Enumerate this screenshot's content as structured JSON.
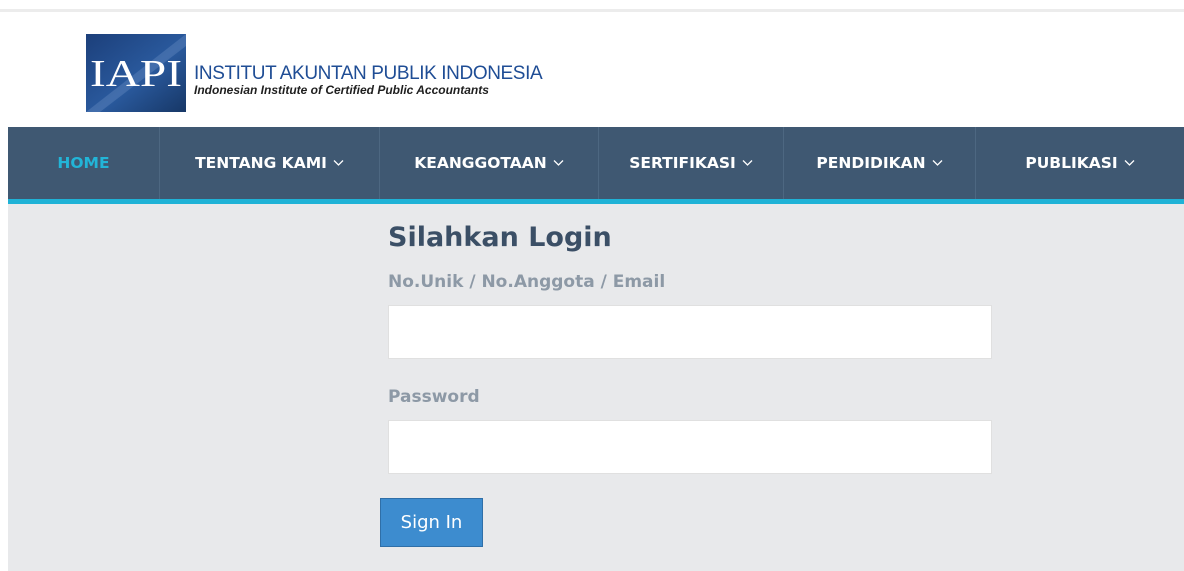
{
  "logo": {
    "mark_text": "IAPI",
    "title": "INSTITUT AKUNTAN PUBLIK INDONESIA",
    "subtitle": "Indonesian Institute of Certified Public Accountants"
  },
  "nav": {
    "items": [
      {
        "label": "HOME",
        "active": true,
        "dropdown": false
      },
      {
        "label": "TENTANG KAMI",
        "active": false,
        "dropdown": true
      },
      {
        "label": "KEANGGOTAAN",
        "active": false,
        "dropdown": true
      },
      {
        "label": "SERTIFIKASI",
        "active": false,
        "dropdown": true
      },
      {
        "label": "PENDIDIKAN",
        "active": false,
        "dropdown": true
      },
      {
        "label": "PUBLIKASI",
        "active": false,
        "dropdown": true
      }
    ],
    "dropdown_icon": "chevron-down-icon"
  },
  "login": {
    "title": "Silahkan Login",
    "username_label": "No.Unik / No.Anggota / Email",
    "username_value": "",
    "password_label": "Password",
    "password_value": "",
    "submit_label": "Sign In"
  },
  "colors": {
    "nav_background": "#3f5872",
    "nav_active": "#22b5d8",
    "accent_rule": "#1fb2d6",
    "content_background": "#e8e9eb",
    "button": "#3d8ccf",
    "logo_blue": "#1f4d95"
  }
}
